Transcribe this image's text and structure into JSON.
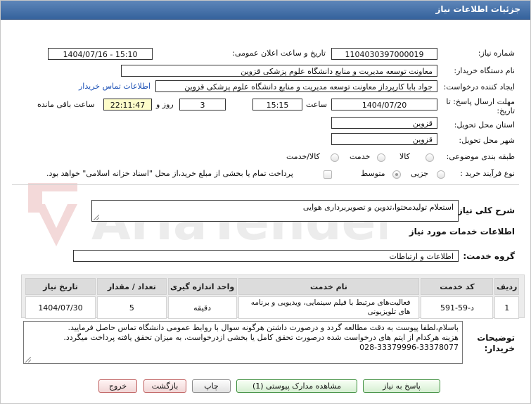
{
  "window": {
    "title": "جزئیات اطلاعات نیاز"
  },
  "form": {
    "need_number_label": "شماره نیاز:",
    "need_number": "1104030397000019",
    "announce_label": "تاریخ و ساعت اعلان عمومی:",
    "announce_value": "1404/07/16 - 15:10",
    "buyer_label": "نام دستگاه خریدار:",
    "buyer_value": "معاونت توسعه مدیریت و منابع دانشگاه علوم پزشکی قزوین",
    "creator_label": "ایجاد کننده درخواست:",
    "creator_value": "جواد بابا کارپرداز معاونت توسعه مدیریت و منابع دانشگاه علوم پزشکی قزوین",
    "contact_link": "اطلاعات تماس خریدار",
    "deadline_label_line1": "مهلت ارسال پاسخ: تا",
    "deadline_label_line2": "تاریخ:",
    "deadline_date": "1404/07/20",
    "time_label": "ساعت",
    "deadline_time": "15:15",
    "days_value": "3",
    "days_label": "روز و",
    "remaining_value": "22:11:47",
    "remaining_label": "ساعت باقی مانده",
    "province_label": "استان محل تحویل:",
    "province_value": "قزوین",
    "city_label": "شهر محل تحویل:",
    "city_value": "قزوین",
    "category_label": "طبقه بندی موضوعی:",
    "category_options": [
      "کالا",
      "خدمت",
      "کالا/خدمت"
    ],
    "process_label": "نوع فرآیند خرید :",
    "process_options": [
      "جزیی",
      "متوسط"
    ],
    "payment_note": "پرداخت تمام یا بخشی از مبلغ خرید،از محل \"اسناد خزانه اسلامی\" خواهد بود."
  },
  "summary": {
    "label": "شرح کلی نیاز:",
    "value": "استعلام تولیدمحتوا،تدوین و تصویربرداری هوایی"
  },
  "services": {
    "heading": "اطلاعات خدمات مورد نیاز",
    "group_label": "گروه خدمت:",
    "group_value": "اطلاعات و ارتباطات"
  },
  "table": {
    "headers": [
      "ردیف",
      "کد خدمت",
      "نام خدمت",
      "واحد اندازه گیری",
      "تعداد / مقدار",
      "تاریخ نیاز"
    ],
    "rows": [
      [
        "1",
        "د-59-591",
        "فعالیت‌های مرتبط با فیلم سینمایی، ویدیویی و برنامه های تلویزیونی",
        "دقیقه",
        "5",
        "1404/07/30"
      ]
    ]
  },
  "buyer_notes": {
    "label_line1": "توضیحات",
    "label_line2": "خریدار:",
    "line1": "باسلام،لطفا پیوست به دقت مطالعه گردد و درصورت داشتن هرگونه سوال با روابط عمومی دانشگاه تماس حاصل فرمایید.",
    "line2": "هزینه هرکدام از ایتم های درخواست شده درصورت تحقق کامل یا بخشی ازدرخواست، به میزان تحقق یافته پرداخت میگردد.",
    "line3": "028-33379996-33378077"
  },
  "buttons": {
    "reply": "پاسخ به نیاز",
    "attachments": "مشاهده مدارک پیوستی (1)",
    "print": "چاپ",
    "back": "بازگشت",
    "exit": "خروج"
  },
  "watermark": {
    "text": "AriaTender.net"
  },
  "colors": {
    "titlebar": "#35629c",
    "link": "#1a4fb5",
    "remaining_bg": "#fdfcc9",
    "green_button_border": "#3f8f3f",
    "red_button_border": "#c06060"
  }
}
